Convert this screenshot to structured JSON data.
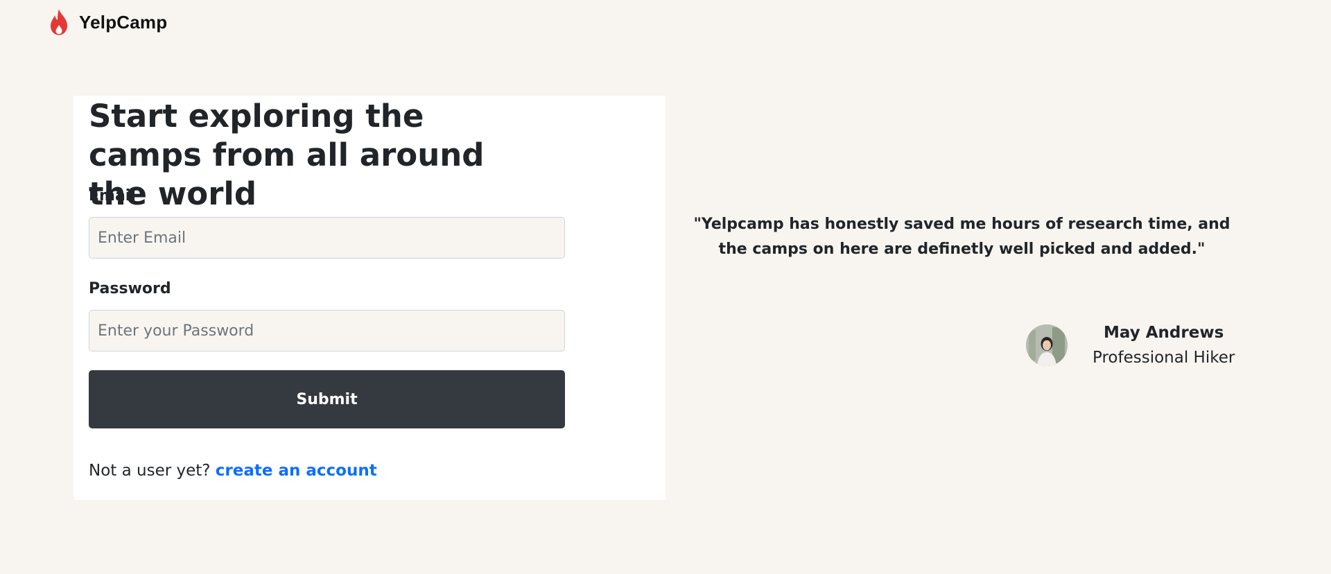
{
  "brand": {
    "name": "YelpCamp",
    "logo_icon": "flame-icon",
    "logo_color": "#e53935"
  },
  "login": {
    "heading": "Start exploring the camps from all around the world",
    "email_label": "Email",
    "email_placeholder": "Enter Email",
    "email_value": "",
    "password_label": "Password",
    "password_placeholder": "Enter your Password",
    "password_value": "",
    "submit_label": "Submit",
    "signup_prompt": "Not a user yet?",
    "signup_link": "create an account"
  },
  "testimonial": {
    "quote": "\"Yelpcamp has honestly saved me hours of research time, and the camps on here are definetly well picked and added.\"",
    "author_name": "May Andrews",
    "author_role": "Professional Hiker",
    "avatar_icon": "user-avatar"
  },
  "colors": {
    "background": "#f8f5f0",
    "button": "#343a40",
    "link": "#0d6efd"
  }
}
